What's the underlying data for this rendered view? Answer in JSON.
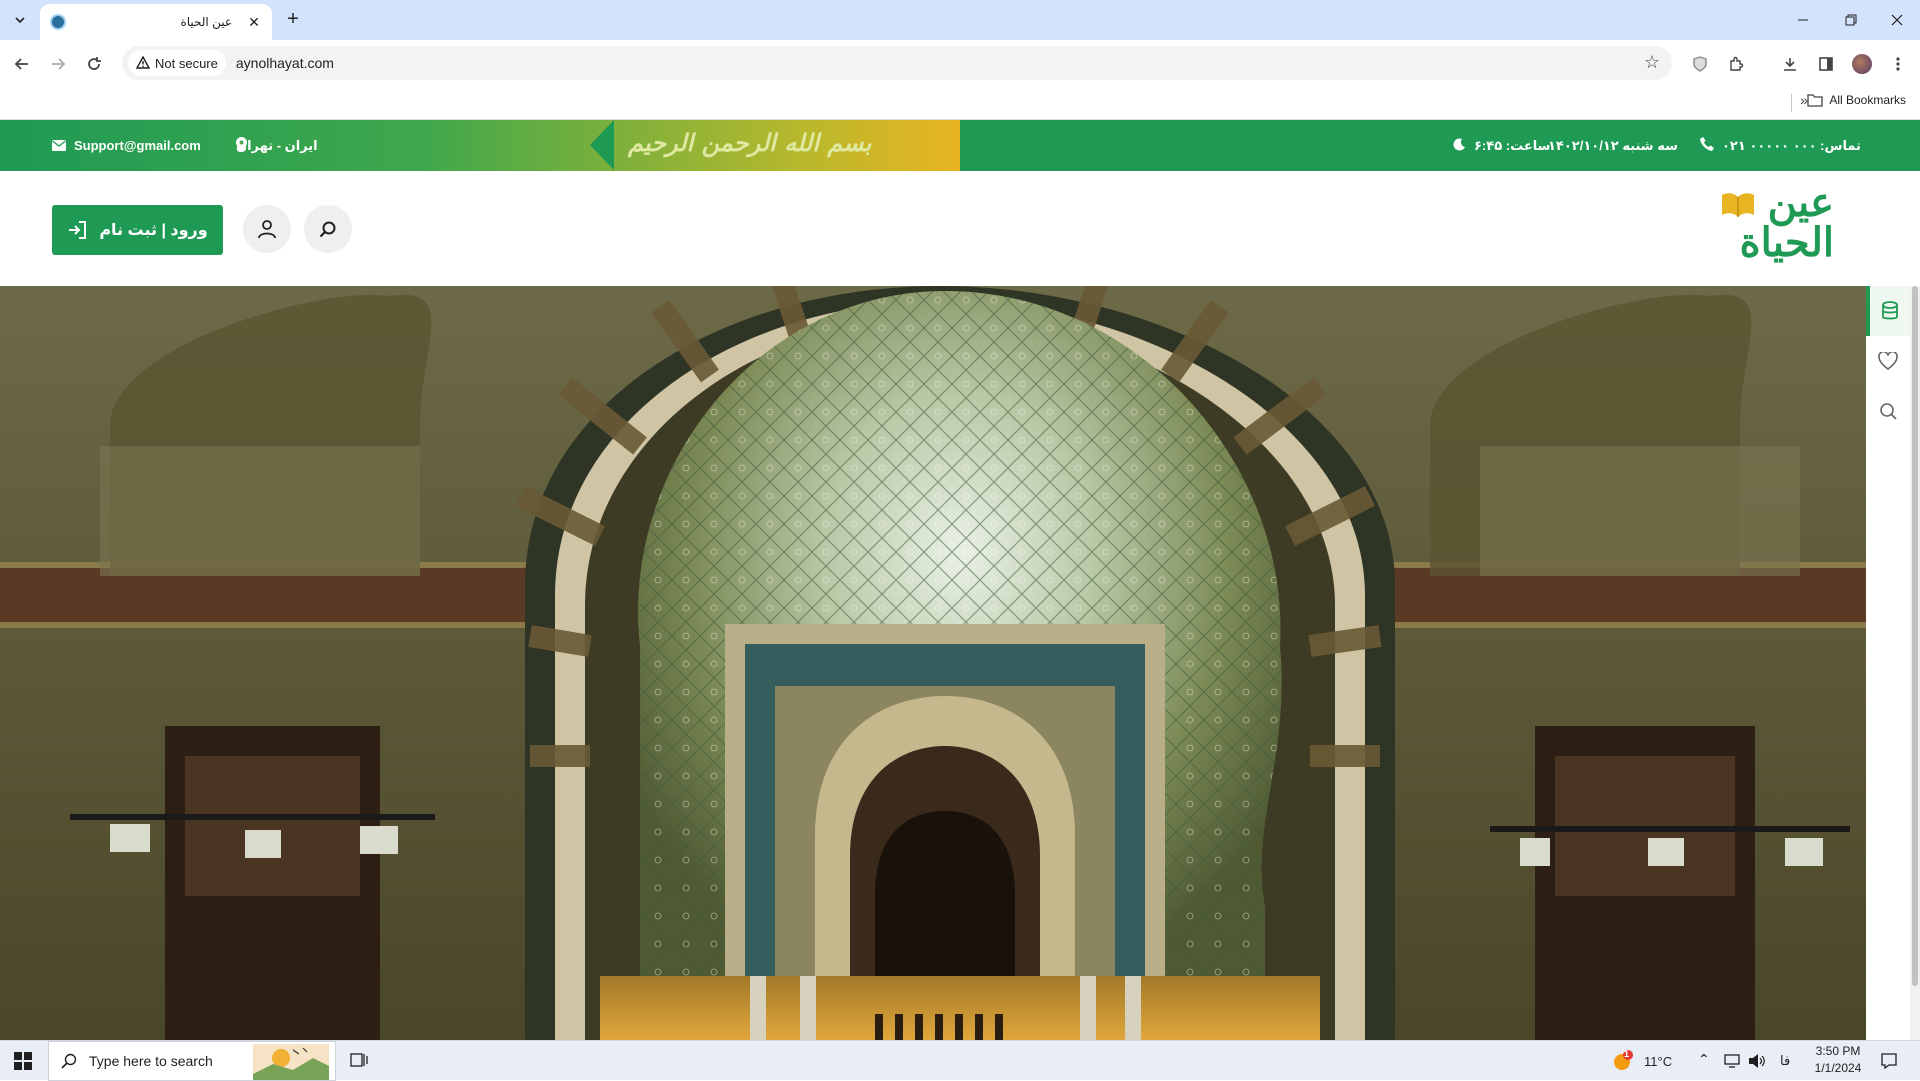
{
  "browser": {
    "tab_title": "عين الحياة",
    "security_label": "Not secure",
    "url": "aynolhayat.com",
    "bookmarks_label": "All Bookmarks"
  },
  "topbar": {
    "contact": "تماس: ۰۰۰ ۰۰۰۰۰ ۰۲۱",
    "date": "سه شنبه ۱۴۰۲/۱۰/۱۲",
    "time": "ساعت: ۶:۴۵",
    "location": "ایران - تهران",
    "email": "Support@gmail.com",
    "basmala": "بسم الله الرحمن الرحيم"
  },
  "header": {
    "login_label": "ورود | ثبت نام",
    "logo_line1": "عين",
    "logo_line2": "الحياة"
  },
  "taskbar": {
    "search_placeholder": "Type here to search",
    "temperature": "11°C",
    "language": "فا",
    "time": "3:50 PM",
    "date": "1/1/2024",
    "weather_badge": "1"
  },
  "colors": {
    "brand_green": "#1f9a55",
    "gold": "#e8b422"
  },
  "icons": {
    "side_tools": [
      "database-icon",
      "heart-icon",
      "search-icon"
    ]
  }
}
